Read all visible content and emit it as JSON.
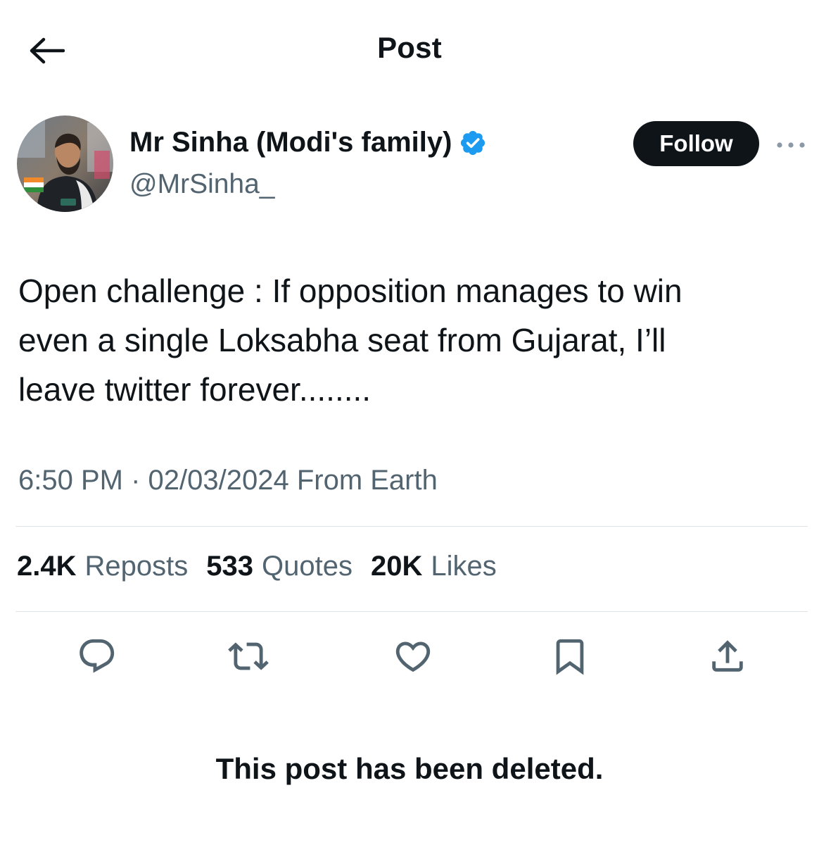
{
  "header": {
    "title": "Post",
    "back_icon": "arrow-left-icon"
  },
  "author": {
    "name": "Mr Sinha (Modi's family)",
    "handle": "@MrSinha_",
    "verified_icon": "verified-badge-icon",
    "verified_color": "#1d9bf0",
    "follow_label": "Follow",
    "more_icon": "more-horizontal-icon"
  },
  "post": {
    "text": "Open challenge : If opposition manages to win\neven a single Loksabha seat from Gujarat, I’ll\nleave twitter forever........",
    "timestamp": "6:50 PM · 02/03/2024 From Earth"
  },
  "stats": [
    {
      "count": "2.4K",
      "label": "Reposts"
    },
    {
      "count": "533",
      "label": "Quotes"
    },
    {
      "count": "20K",
      "label": "Likes"
    }
  ],
  "actions": [
    {
      "name": "reply",
      "icon": "reply-icon"
    },
    {
      "name": "repost",
      "icon": "repost-icon"
    },
    {
      "name": "like",
      "icon": "heart-icon"
    },
    {
      "name": "bookmark",
      "icon": "bookmark-icon"
    },
    {
      "name": "share",
      "icon": "share-icon"
    }
  ],
  "notice": {
    "deleted_text": "This post has been deleted."
  },
  "colors": {
    "text_primary": "#0f1419",
    "text_secondary": "#536471",
    "divider": "#dfe4e8",
    "follow_bg": "#0f1419"
  }
}
